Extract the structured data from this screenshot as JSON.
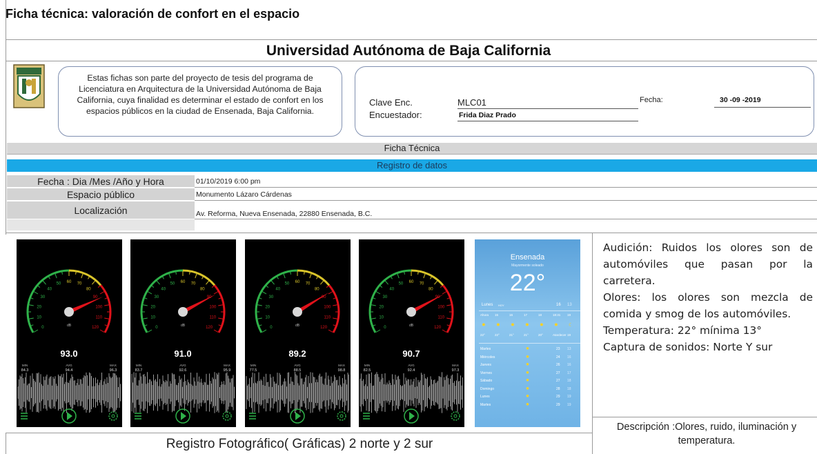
{
  "header": {
    "title": "Ficha técnica: valoración de confort en el espacio",
    "university": "Universidad Autónoma de Baja California"
  },
  "intro": {
    "text": "Estas fichas son parte del proyecto de tesis del programa de Licenciatura en Arquitectura de la Universidad Autónoma de Baja California, cuya finalidad es determinar el estado de confort en los espacios públicos en la ciudad de Ensenada, Baja California."
  },
  "survey": {
    "clave_label": "Clave Enc.",
    "clave_value": "MLC01",
    "encuestador_label": "Encuestador:",
    "encuestador_value": "Frida Diaz Prado",
    "fecha_label": "Fecha:",
    "fecha_value": "30 -09 -2019"
  },
  "sections": {
    "ficha": "Ficha Técnica",
    "registro": "Registro de datos"
  },
  "rows": [
    {
      "label": "Fecha : Dia /Mes /Año  y Hora",
      "value": "01/10/2019  6:00 pm"
    },
    {
      "label": "Espacio público",
      "value": "Monumento Lázaro Cárdenas"
    },
    {
      "label": "Localización",
      "value": "Av. Reforma, Nueva Ensenada, 22880 Ensenada, B.C."
    }
  ],
  "meters": [
    {
      "reading": "93.0",
      "min": "84.3",
      "avg": "94.4",
      "max": "96.3",
      "level": 93.0
    },
    {
      "reading": "91.0",
      "min": "83.7",
      "avg": "92.6",
      "max": "95.9",
      "level": 91.0
    },
    {
      "reading": "89.2",
      "min": "77.5",
      "avg": "88.5",
      "max": "98.8",
      "level": 89.2
    },
    {
      "reading": "90.7",
      "min": "82.5",
      "avg": "92.4",
      "max": "97.3",
      "level": 90.7
    }
  ],
  "meter_labels": {
    "unit": "dB",
    "min": "MIN",
    "avg": "AVG",
    "max": "MAX"
  },
  "weather": {
    "city": "Ensenada",
    "condition": "Mayormente soleado",
    "temp": "22°",
    "today": "Lunes",
    "today_tag": "HOY",
    "today_hi": "16",
    "today_lo": "13",
    "hours": [
      "Ahora",
      "15",
      "16",
      "17",
      "18",
      "18:31",
      "19"
    ],
    "hour_temps": [
      "22°",
      "22°",
      "21°",
      "21°",
      "20°",
      "Atardecer",
      "19"
    ],
    "days": [
      {
        "name": "Martes",
        "hi": "23",
        "lo": "13"
      },
      {
        "name": "Miércoles",
        "hi": "24",
        "lo": "16"
      },
      {
        "name": "Jueves",
        "hi": "26",
        "lo": "16"
      },
      {
        "name": "Viernes",
        "hi": "27",
        "lo": "17"
      },
      {
        "name": "Sábado",
        "hi": "27",
        "lo": "18"
      },
      {
        "name": "Domingo",
        "hi": "28",
        "lo": "18"
      },
      {
        "name": "Lunes",
        "hi": "29",
        "lo": "19"
      },
      {
        "name": "Martes",
        "hi": "29",
        "lo": "19"
      }
    ]
  },
  "observations": {
    "audicion": "Audición: Ruidos los olores son de automóviles que pasan por la carretera.",
    "olores": "Olores:  los olores son mezcla de comida y smog de los automóviles.",
    "temperatura": "Temperatura: 22° mínima 13°",
    "captura": "Captura de sonidos: Norte Y sur"
  },
  "description": "Descripción :Olores, ruido, iluminación y temperatura.",
  "caption": "Registro Fotográfico( Gráficas) 2 norte y 2 sur",
  "colors": {
    "accent_blue": "#1aa8e6",
    "gray_band": "#d3d3d3",
    "needle_red": "#e0121a"
  }
}
